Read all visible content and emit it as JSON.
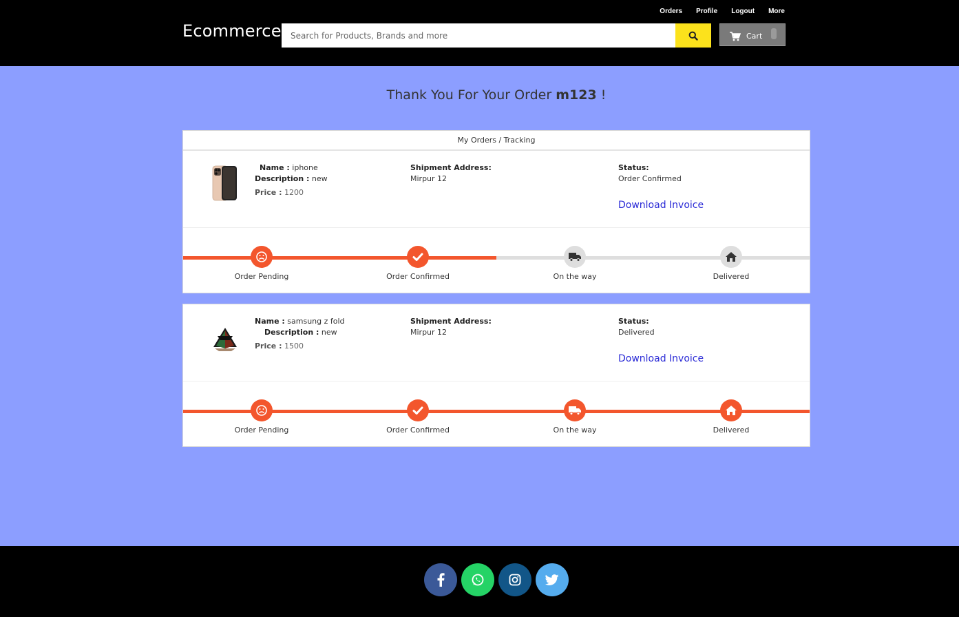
{
  "header": {
    "brand": "Ecommerce",
    "links": [
      "Orders",
      "Profile",
      "Logout",
      "More"
    ],
    "search_placeholder": "Search for Products, Brands and more",
    "cart_label": "Cart"
  },
  "main": {
    "thank_you_prefix": "Thank You For Your Order",
    "username": "m123",
    "thank_you_suffix": "!",
    "section_title": "My Orders / Tracking"
  },
  "orders": [
    {
      "name_label": "Name :",
      "name": "iphone",
      "description_label": "Description :",
      "description": "new",
      "price_label": "Price :",
      "price": "1200",
      "shipment_label": "Shipment Address:",
      "shipment_address": "Mirpur 12",
      "status_label": "Status:",
      "status": "Order Confirmed",
      "invoice_label": "Download Invoice",
      "progress_completed_steps": 2
    },
    {
      "name_label": "Name :",
      "name": "samsung z fold",
      "description_label": "Description :",
      "description": "new",
      "price_label": "Price :",
      "price": "1500",
      "shipment_label": "Shipment Address:",
      "shipment_address": "Mirpur 12",
      "status_label": "Status:",
      "status": "Delivered",
      "invoice_label": "Download Invoice",
      "progress_completed_steps": 4
    }
  ],
  "tracking_steps": [
    "Order Pending",
    "Order Confirmed",
    "On the way",
    "Delivered"
  ],
  "colors": {
    "accent": "#f3562d",
    "inactive": "#dedede",
    "page_bg": "#8c9eff",
    "search_button": "#fce21c",
    "link": "#2a2ad6"
  },
  "footer": {
    "social_icons": [
      "facebook-icon",
      "whatsapp-icon",
      "instagram-icon",
      "twitter-icon"
    ]
  }
}
